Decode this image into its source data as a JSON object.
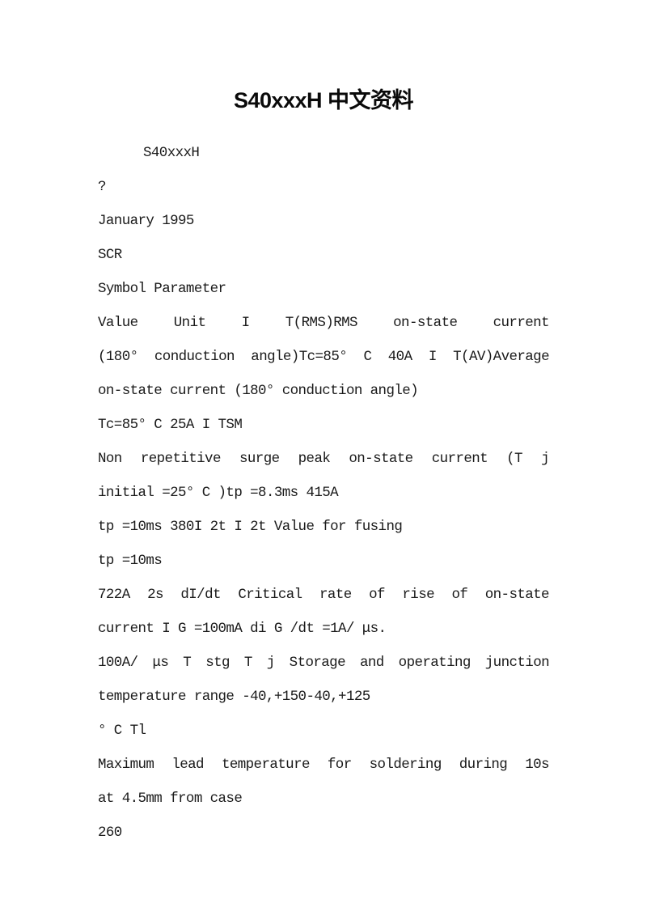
{
  "document": {
    "title": "S40xxxH 中文资料",
    "lines": [
      {
        "text": "S40xxxH",
        "indent": true,
        "justify": false
      },
      {
        "text": "?",
        "indent": false,
        "justify": false
      },
      {
        "text": "January 1995",
        "indent": false,
        "justify": false
      },
      {
        "text": "SCR",
        "indent": false,
        "justify": false
      },
      {
        "text": "Symbol Parameter",
        "indent": false,
        "justify": false
      },
      {
        "text": "Value Unit I T(RMS)RMS on-state current",
        "indent": false,
        "justify": true
      },
      {
        "text": "(180° conduction angle)Tc=85° C 40A I T(AV)Average",
        "indent": false,
        "justify": true
      },
      {
        "text": "on-state current (180° conduction angle)",
        "indent": false,
        "justify": false
      },
      {
        "text": "Tc=85° C 25A I TSM",
        "indent": false,
        "justify": false
      },
      {
        "text": "Non repetitive surge peak on-state current (T j",
        "indent": false,
        "justify": true
      },
      {
        "text": "initial =25° C )tp =8.3ms 415A",
        "indent": false,
        "justify": false
      },
      {
        "text": "tp =10ms 380I 2t I 2t Value for fusing",
        "indent": false,
        "justify": false
      },
      {
        "text": "tp =10ms",
        "indent": false,
        "justify": false
      },
      {
        "text": "722A 2s dI/dt Critical rate of rise of on-state",
        "indent": false,
        "justify": true
      },
      {
        "text": "current I G =100mA di G /dt =1A/ μs.",
        "indent": false,
        "justify": false
      },
      {
        "text": "100A/ μs T stg T j Storage and operating junction",
        "indent": false,
        "justify": true
      },
      {
        "text": "temperature range -40,+150-40,+125",
        "indent": false,
        "justify": false
      },
      {
        "text": "° C Tl",
        "indent": false,
        "justify": false
      },
      {
        "text": "Maximum lead temperature for soldering during 10s",
        "indent": false,
        "justify": true
      },
      {
        "text": "at 4.5mm from case",
        "indent": false,
        "justify": false
      },
      {
        "text": "260",
        "indent": false,
        "justify": false
      }
    ]
  }
}
